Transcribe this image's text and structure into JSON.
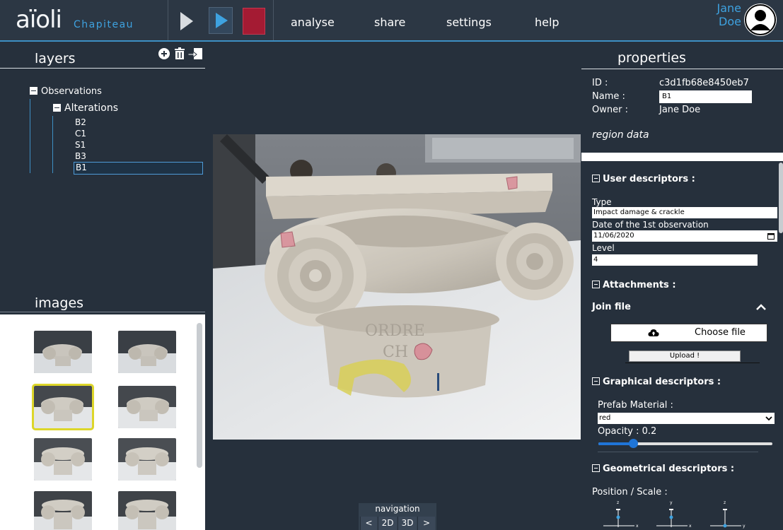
{
  "app": {
    "logo": "aïoli",
    "project": "Chapiteau"
  },
  "menu": [
    "analyse",
    "share",
    "settings",
    "help"
  ],
  "user": {
    "first": "Jane",
    "last": "Doe"
  },
  "layers": {
    "title": "layers",
    "root": "Observations",
    "group": "Alterations",
    "items": [
      "B2",
      "C1",
      "S1",
      "B3",
      "B1"
    ],
    "selected": "B1"
  },
  "images": {
    "title": "images"
  },
  "navigation": {
    "label": "navigation",
    "prev": "<",
    "mode2d": "2D",
    "mode3d": "3D",
    "next": ">"
  },
  "properties": {
    "title": "properties",
    "id_label": "ID :",
    "id_value": "c3d1fb68e8450eb7",
    "name_label": "Name :",
    "name_value": "B1",
    "owner_label": "Owner :",
    "owner_value": "Jane Doe",
    "region": "region data",
    "user_descriptors": "User descriptors :",
    "type_label": "Type",
    "type_value": "Impact damage & crackle",
    "date_label": "Date of the 1st observation",
    "date_value": "11/06/2020",
    "level_label": "Level",
    "level_value": "4",
    "attachments": "Attachments :",
    "join_file": "Join file",
    "choose_file": "Choose file",
    "upload": "Upload !",
    "graphical": "Graphical descriptors :",
    "prefab_label": "Prefab Material :",
    "prefab_value": "red",
    "opacity_label": "Opacity : 0.2",
    "opacity_value": 0.2,
    "geometrical": "Geometrical descriptors :",
    "position_scale": "Position / Scale :"
  },
  "gizmos": [
    {
      "up": "z",
      "right": "x"
    },
    {
      "up": "y",
      "right": "x"
    },
    {
      "up": "z",
      "right": "y"
    }
  ],
  "colors": {
    "accent": "#3ea2e0",
    "stop": "#a41b33",
    "slider": "#1f75d8",
    "selected_thumb": "#ddd62a"
  }
}
